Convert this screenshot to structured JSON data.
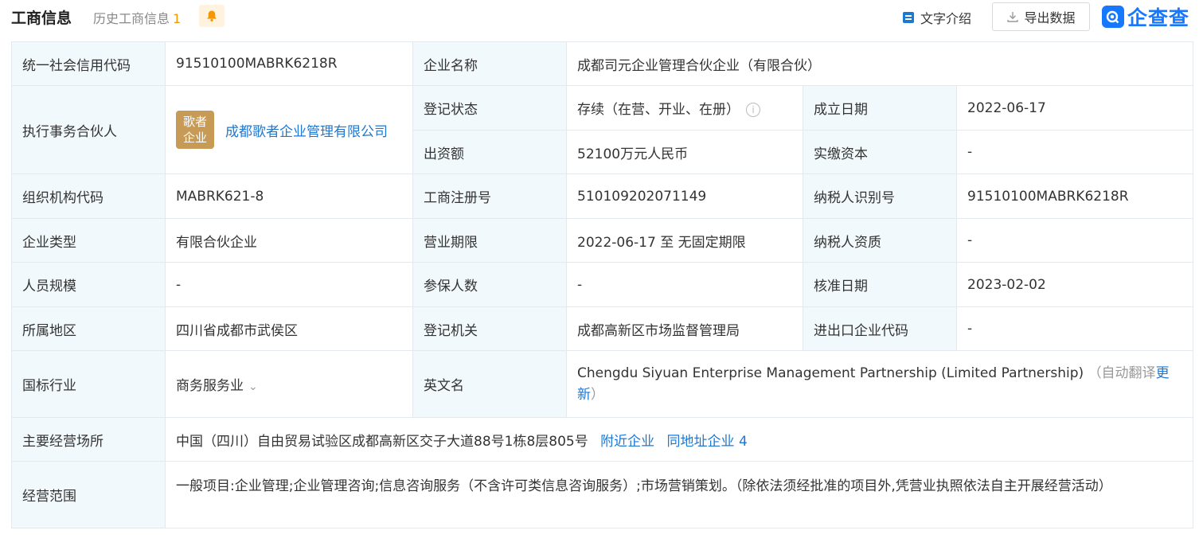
{
  "header": {
    "title": "工商信息",
    "history_label": "历史工商信息",
    "history_count": "1",
    "text_intro_label": "文字介绍",
    "export_label": "导出数据",
    "logo_text": "企查查"
  },
  "rows": {
    "credit_code": {
      "label": "统一社会信用代码",
      "value": "91510100MABRK6218R"
    },
    "company_name": {
      "label": "企业名称",
      "value": "成都司元企业管理合伙企业（有限合伙）"
    },
    "partner": {
      "label": "执行事务合伙人",
      "badge_line1": "歌者",
      "badge_line2": "企业",
      "value": "成都歌者企业管理有限公司"
    },
    "reg_status": {
      "label": "登记状态",
      "value": "存续（在营、开业、在册）"
    },
    "found_date": {
      "label": "成立日期",
      "value": "2022-06-17"
    },
    "capital": {
      "label": "出资额",
      "value": "52100万元人民币"
    },
    "paid_capital": {
      "label": "实缴资本",
      "value": "-"
    },
    "org_code": {
      "label": "组织机构代码",
      "value": "MABRK621-8"
    },
    "reg_no": {
      "label": "工商注册号",
      "value": "510109202071149"
    },
    "tax_id": {
      "label": "纳税人识别号",
      "value": "91510100MABRK6218R"
    },
    "company_type": {
      "label": "企业类型",
      "value": "有限合伙企业"
    },
    "term": {
      "label": "营业期限",
      "value": "2022-06-17 至 无固定期限"
    },
    "tax_qual": {
      "label": "纳税人资质",
      "value": "-"
    },
    "staff": {
      "label": "人员规模",
      "value": "-"
    },
    "insured": {
      "label": "参保人数",
      "value": "-"
    },
    "approve_date": {
      "label": "核准日期",
      "value": "2023-02-02"
    },
    "region": {
      "label": "所属地区",
      "value": "四川省成都市武侯区"
    },
    "authority": {
      "label": "登记机关",
      "value": "成都高新区市场监督管理局"
    },
    "import_code": {
      "label": "进出口企业代码",
      "value": "-"
    },
    "industry": {
      "label": "国标行业",
      "value": "商务服务业"
    },
    "english_name": {
      "label": "英文名",
      "value": "Chengdu Siyuan Enterprise Management Partnership (Limited Partnership)",
      "note_open": "（自动翻译",
      "update_label": "更新",
      "note_close": "）"
    },
    "address": {
      "label": "主要经营场所",
      "value": "中国（四川）自由贸易试验区成都高新区交子大道88号1栋8层805号",
      "nearby_label": "附近企业",
      "same_addr_label": "同地址企业",
      "same_addr_count": "4"
    },
    "scope": {
      "label": "经营范围",
      "value": "一般项目:企业管理;企业管理咨询;信息咨询服务（不含许可类信息咨询服务）;市场营销策划。（除依法须经批准的项目外,凭营业执照依法自主开展经营活动）"
    }
  }
}
